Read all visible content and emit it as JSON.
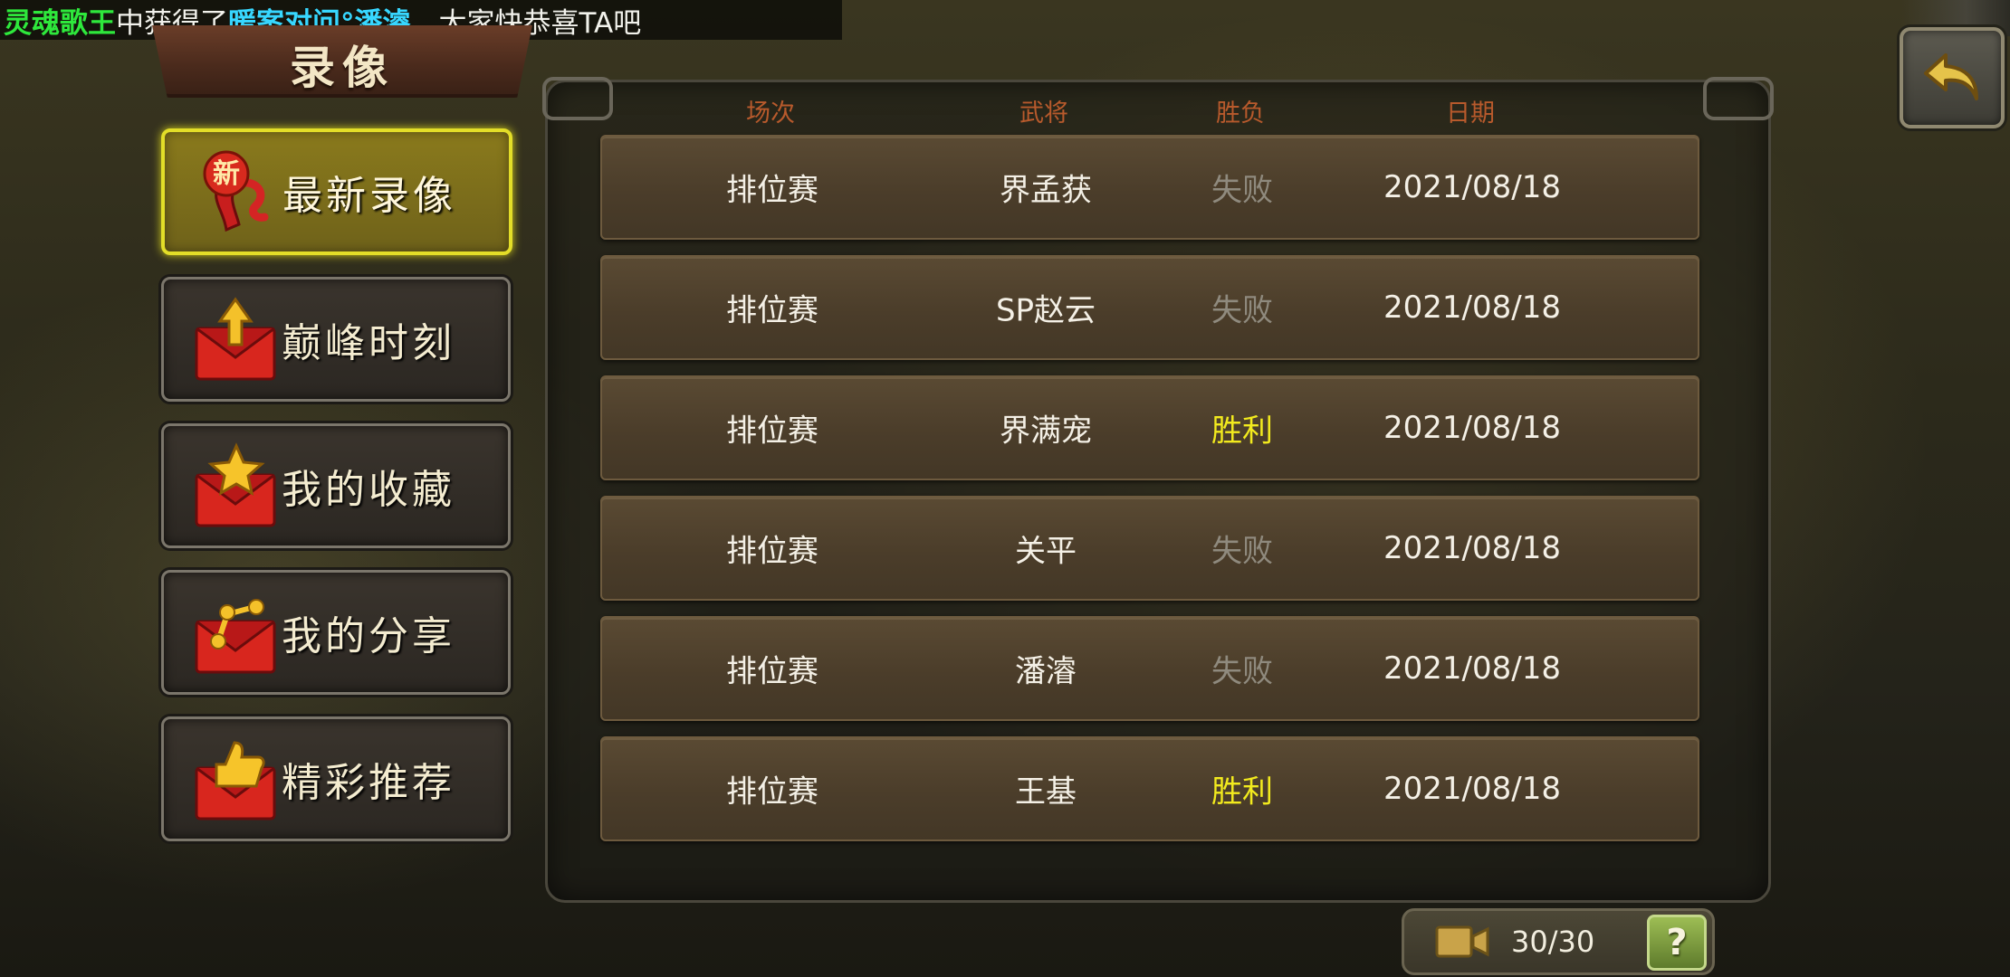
{
  "marquee": {
    "player_name": "灵魂歌王",
    "text_middle": "中获得了",
    "general_name": "暖案对问°潘濬",
    "text_end": "，大家快恭喜TA吧"
  },
  "title": "录像",
  "menu": [
    {
      "label": "最新录像",
      "icon": "new-ribbon-icon",
      "active": true
    },
    {
      "label": "巅峰时刻",
      "icon": "arrow-envelope-icon",
      "active": false
    },
    {
      "label": "我的收藏",
      "icon": "star-envelope-icon",
      "active": false
    },
    {
      "label": "我的分享",
      "icon": "share-envelope-icon",
      "active": false
    },
    {
      "label": "精彩推荐",
      "icon": "thumbs-envelope-icon",
      "active": false
    }
  ],
  "columns": {
    "mode": "场次",
    "general": "武将",
    "result": "胜负",
    "date": "日期"
  },
  "records": [
    {
      "mode": "排位赛",
      "general": "界孟获",
      "result": "失败",
      "outcome": "lose",
      "date": "2021/08/18"
    },
    {
      "mode": "排位赛",
      "general": "SP赵云",
      "result": "失败",
      "outcome": "lose",
      "date": "2021/08/18"
    },
    {
      "mode": "排位赛",
      "general": "界满宠",
      "result": "胜利",
      "outcome": "win",
      "date": "2021/08/18"
    },
    {
      "mode": "排位赛",
      "general": "关平",
      "result": "失败",
      "outcome": "lose",
      "date": "2021/08/18"
    },
    {
      "mode": "排位赛",
      "general": "潘濬",
      "result": "失败",
      "outcome": "lose",
      "date": "2021/08/18"
    },
    {
      "mode": "排位赛",
      "general": "王基",
      "result": "胜利",
      "outcome": "win",
      "date": "2021/08/18"
    }
  ],
  "counter": {
    "text": "30/30",
    "icon": "video-camera-icon"
  },
  "help": {
    "label": "?"
  },
  "colors": {
    "win": "#f2ea1e",
    "lose": "#8f8a7e",
    "header": "#b85a2c",
    "active_border": "#e3de28"
  }
}
